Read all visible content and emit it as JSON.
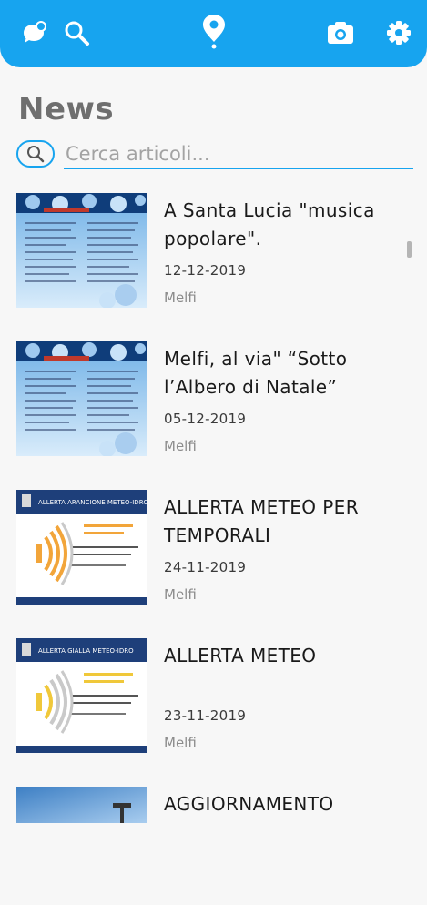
{
  "header": {
    "icons": [
      "chat-icon",
      "search-icon",
      "location-pin-icon",
      "camera-icon",
      "gear-icon"
    ],
    "accent_color": "#17a4ef"
  },
  "page": {
    "title": "News"
  },
  "search": {
    "placeholder": "Cerca articoli..."
  },
  "articles": [
    {
      "title": "A Santa Lucia \"musica popolare\".",
      "date": "12-12-2019",
      "place": "Melfi",
      "thumb": "poster"
    },
    {
      "title": "Melfi, al via\" “Sotto l’Albero di Natale”",
      "date": "05-12-2019",
      "place": "Melfi",
      "thumb": "poster"
    },
    {
      "title": "ALLERTA METEO PER TEMPORALI",
      "date": "24-11-2019",
      "place": "Melfi",
      "thumb": "alert-orange",
      "thumb_header": "ALLERTA ARANCIONE METEO-IDRO",
      "thumb_color": "#f2a53a"
    },
    {
      "title": "ALLERTA METEO",
      "date": "23-11-2019",
      "place": "Melfi",
      "thumb": "alert-yellow",
      "thumb_header": "ALLERTA GIALLA METEO-IDRO",
      "thumb_color": "#f0c83a"
    },
    {
      "title": "AGGIORNAMENTO",
      "date": "",
      "place": "",
      "thumb": "photo"
    }
  ]
}
